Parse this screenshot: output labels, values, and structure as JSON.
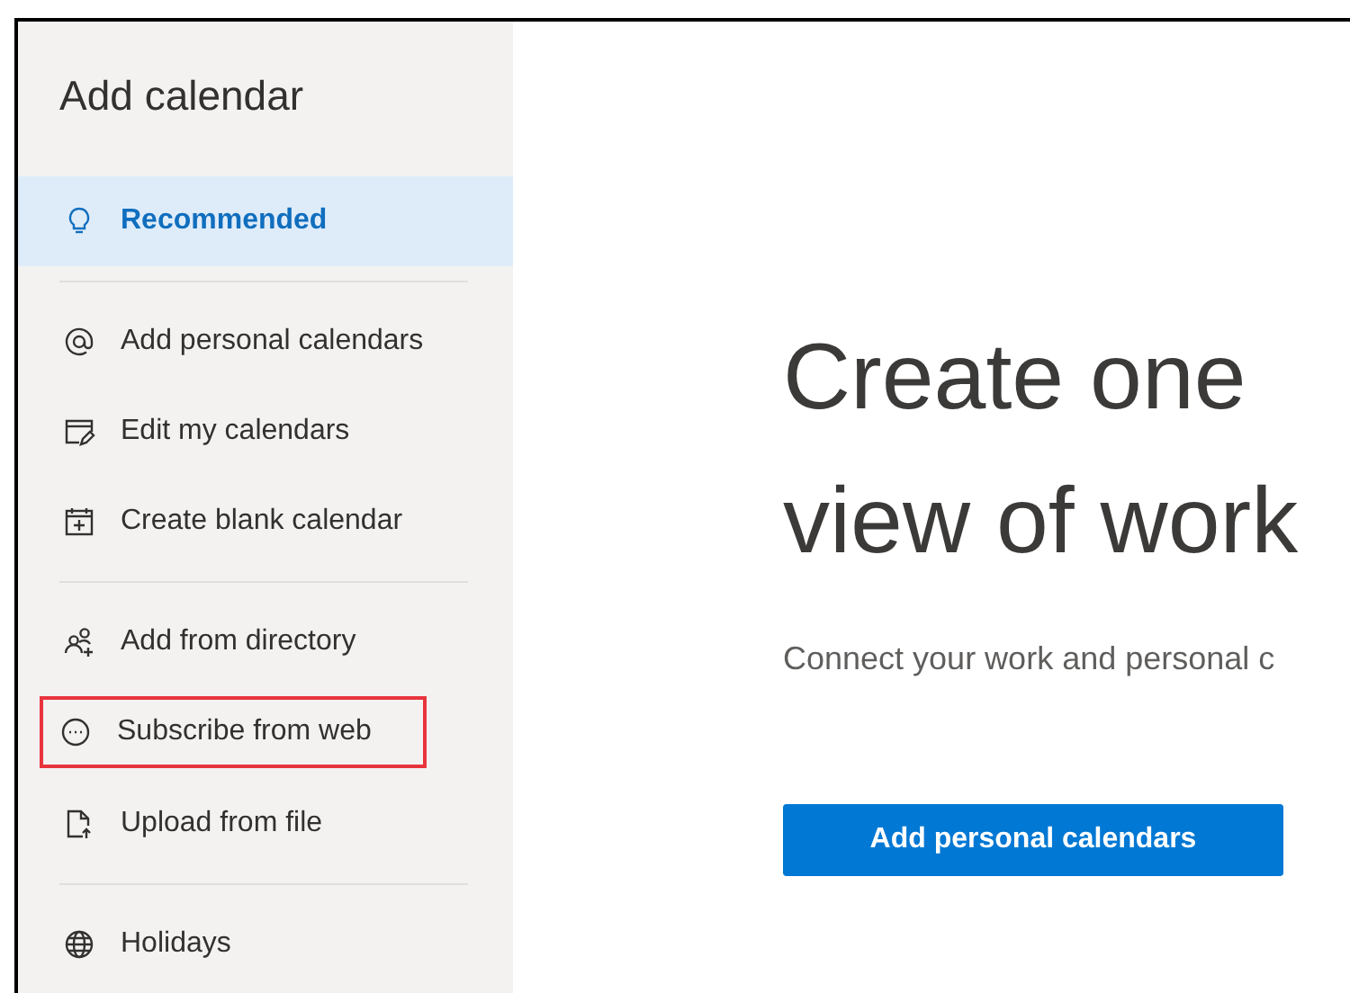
{
  "sidebar": {
    "title": "Add calendar",
    "groups": [
      {
        "items": [
          {
            "label": "Recommended",
            "selected": true,
            "highlighted": false
          }
        ]
      },
      {
        "items": [
          {
            "label": "Add personal calendars",
            "selected": false,
            "highlighted": false
          },
          {
            "label": "Edit my calendars",
            "selected": false,
            "highlighted": false
          },
          {
            "label": "Create blank calendar",
            "selected": false,
            "highlighted": false
          }
        ]
      },
      {
        "items": [
          {
            "label": "Add from directory",
            "selected": false,
            "highlighted": false
          },
          {
            "label": "Subscribe from web",
            "selected": false,
            "highlighted": true
          },
          {
            "label": "Upload from file",
            "selected": false,
            "highlighted": false
          }
        ]
      },
      {
        "items": [
          {
            "label": "Holidays",
            "selected": false,
            "highlighted": false
          }
        ]
      }
    ]
  },
  "main": {
    "headline": [
      "Create one",
      "view of work"
    ],
    "subtitle": "Connect your work and personal c",
    "button": "Add personal calendars"
  }
}
